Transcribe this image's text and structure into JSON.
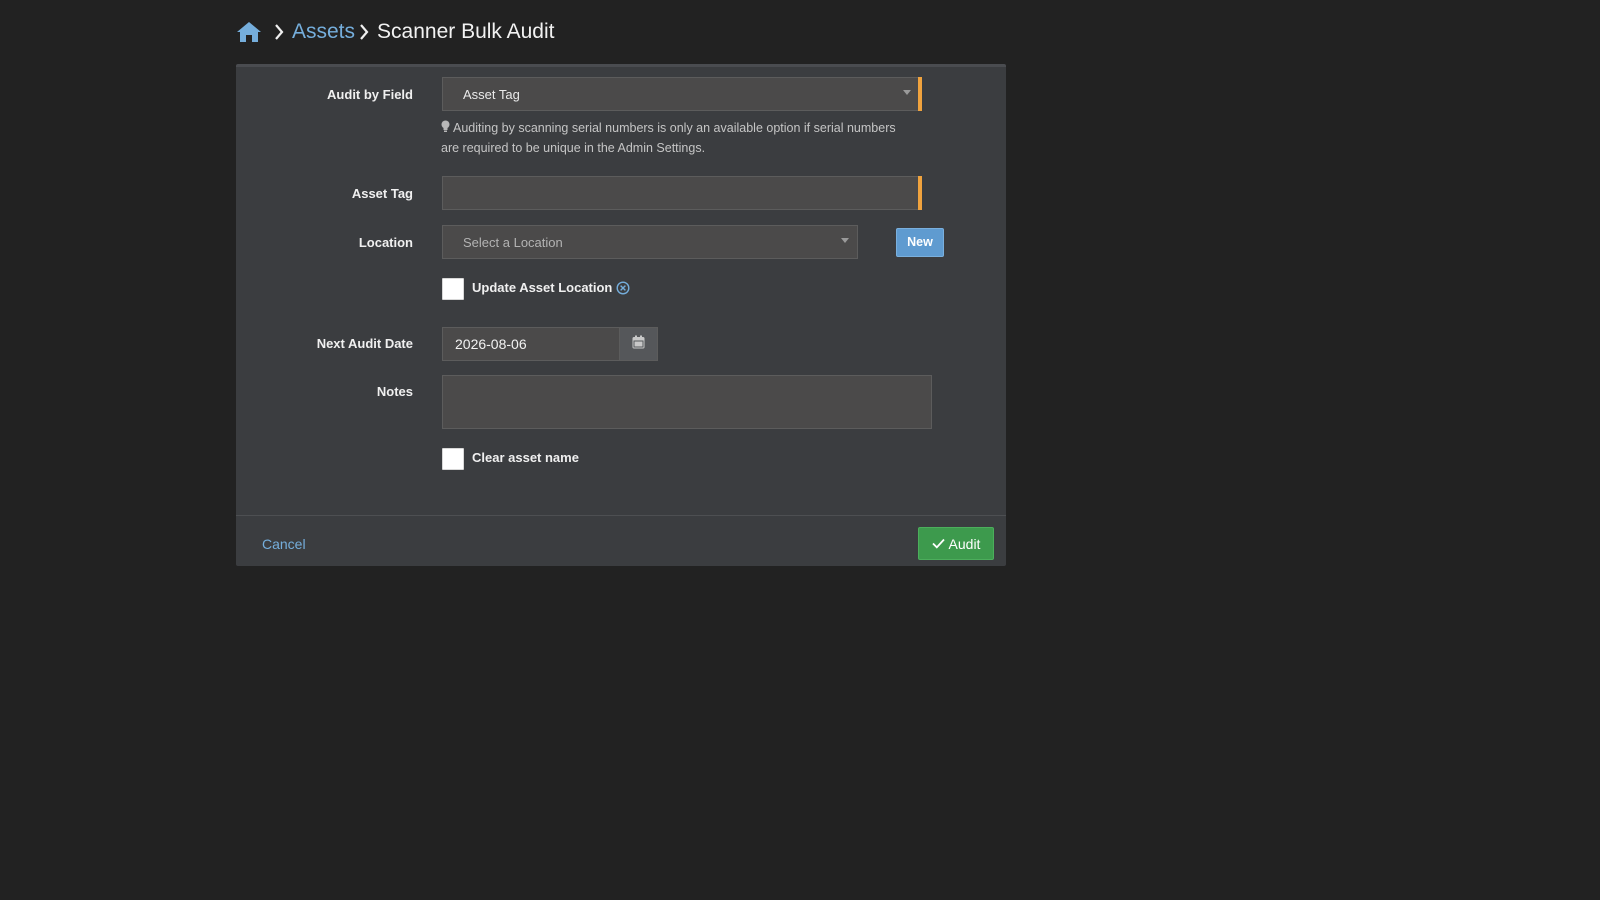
{
  "breadcrumb": {
    "home_icon": "home-icon",
    "items": [
      {
        "label": "Assets"
      },
      {
        "label": "Scanner Bulk Audit"
      }
    ]
  },
  "form": {
    "audit_by_field": {
      "label": "Audit by Field",
      "value": "Asset Tag",
      "help": "Auditing by scanning serial numbers is only an available option if serial numbers are required to be unique in the Admin Settings."
    },
    "asset_tag": {
      "label": "Asset Tag",
      "value": ""
    },
    "location": {
      "label": "Location",
      "placeholder": "Select a Location",
      "new_button": "New"
    },
    "update_location": {
      "label": "Update Asset Location",
      "checked": false
    },
    "next_audit_date": {
      "label": "Next Audit Date",
      "value": "2026-08-06"
    },
    "notes": {
      "label": "Notes",
      "value": ""
    },
    "clear_asset_name": {
      "label": "Clear asset name",
      "checked": false
    }
  },
  "footer": {
    "cancel_label": "Cancel",
    "audit_label": "Audit"
  },
  "colors": {
    "background": "#222222",
    "panel": "#3b3d40",
    "link": "#75aedc",
    "required": "#f0a33e",
    "primary": "#5f9bd0",
    "success": "#3d9a4d"
  }
}
